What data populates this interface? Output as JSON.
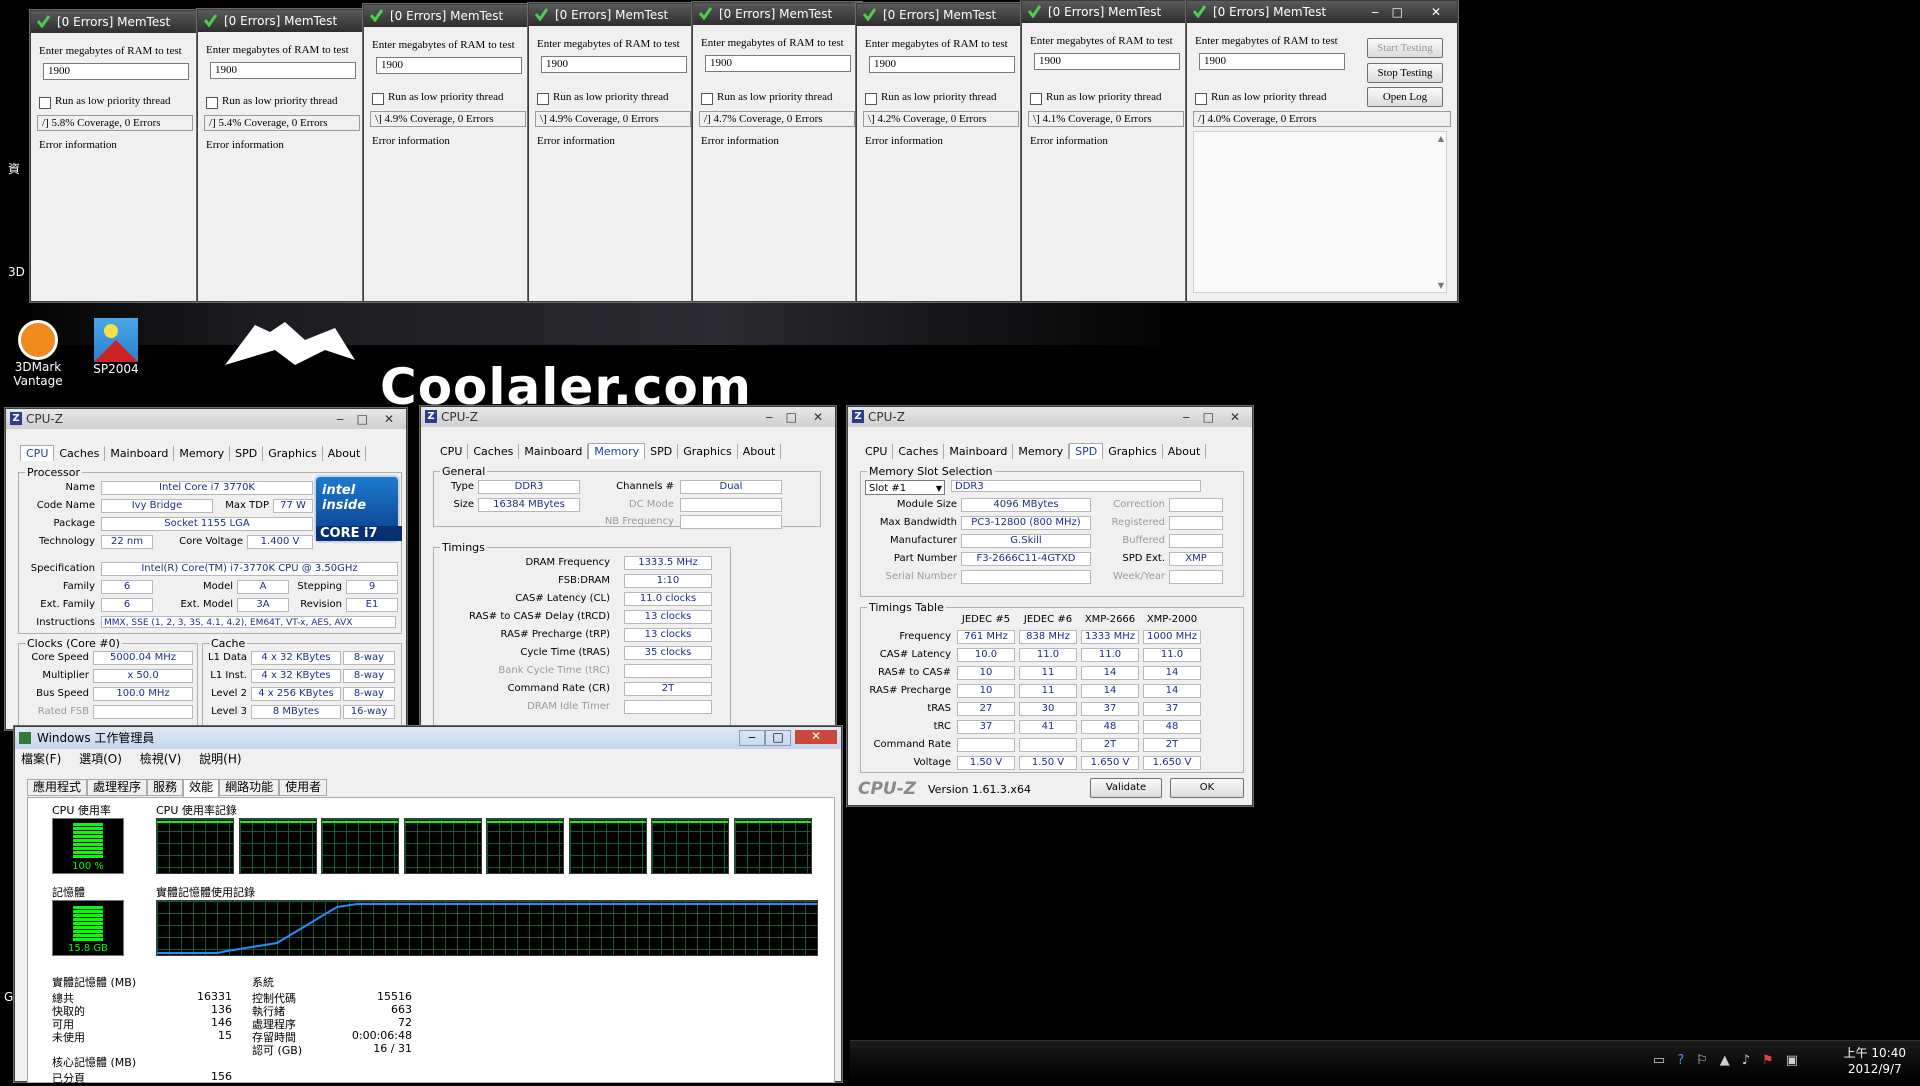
{
  "desktop": {
    "watermark": "Coolaler.com",
    "partial_label_1": "資",
    "partial_label_2": "3D",
    "partial_label_3": "G",
    "icons": [
      {
        "label_line1": "3DMark",
        "label_line2": "Vantage"
      },
      {
        "label_line1": "SP2004"
      }
    ]
  },
  "memtest": {
    "title": "[0 Errors] MemTest",
    "prompt": "Enter megabytes of RAM to test",
    "value": "1900",
    "low_priority": "Run as low priority thread",
    "error_info": "Error information",
    "start": "Start Testing",
    "stop": "Stop Testing",
    "log": "Open Log",
    "windows": [
      {
        "status": "/]   5.8% Coverage, 0 Errors"
      },
      {
        "status": "/]   5.4% Coverage, 0 Errors"
      },
      {
        "status": "\\]   4.9% Coverage, 0 Errors"
      },
      {
        "status": "\\]   4.9% Coverage, 0 Errors"
      },
      {
        "status": "/]   4.7% Coverage, 0 Errors"
      },
      {
        "status": "\\]   4.2% Coverage, 0 Errors"
      },
      {
        "status": "\\]   4.1% Coverage, 0 Errors"
      },
      {
        "status": "/]   4.0% Coverage, 0 Errors"
      }
    ]
  },
  "cpuz": {
    "title": "CPU-Z",
    "tabs": [
      "CPU",
      "Caches",
      "Mainboard",
      "Memory",
      "SPD",
      "Graphics",
      "About"
    ],
    "cpu": {
      "processor_title": "Processor",
      "name_label": "Name",
      "name": "Intel Core i7 3770K",
      "codename_label": "Code Name",
      "codename": "Ivy Bridge",
      "tdp_label": "Max TDP",
      "tdp": "77 W",
      "package_label": "Package",
      "package": "Socket 1155 LGA",
      "tech_label": "Technology",
      "tech": "22 nm",
      "voltage_label": "Core Voltage",
      "voltage": "1.400 V",
      "spec_label": "Specification",
      "spec": "Intel(R) Core(TM) i7-3770K CPU @ 3.50GHz",
      "family_label": "Family",
      "family": "6",
      "model_label": "Model",
      "model": "A",
      "stepping_label": "Stepping",
      "stepping": "9",
      "extfamily_label": "Ext. Family",
      "extfamily": "6",
      "extmodel_label": "Ext. Model",
      "extmodel": "3A",
      "revision_label": "Revision",
      "revision": "E1",
      "instr_label": "Instructions",
      "instr": "MMX, SSE (1, 2, 3, 3S, 4.1, 4.2), EM64T, VT-x, AES, AVX",
      "logo_inside": "intel inside",
      "logo_core": "CORE i7",
      "clocks_title": "Clocks (Core #0)",
      "corespeed_label": "Core Speed",
      "corespeed": "5000.04 MHz",
      "multiplier_label": "Multiplier",
      "multiplier": "x 50.0",
      "bus_label": "Bus Speed",
      "bus": "100.0 MHz",
      "ratedfsb_label": "Rated FSB",
      "cache_title": "Cache",
      "l1d_label": "L1 Data",
      "l1d": "4 x 32 KBytes",
      "l1d_way": "8-way",
      "l1i_label": "L1 Inst.",
      "l1i": "4 x 32 KBytes",
      "l1i_way": "8-way",
      "l2_label": "Level 2",
      "l2": "4 x 256 KBytes",
      "l2_way": "8-way",
      "l3_label": "Level 3",
      "l3": "8 MBytes",
      "l3_way": "16-way"
    },
    "memory": {
      "general_title": "General",
      "type_label": "Type",
      "type": "DDR3",
      "channels_label": "Channels #",
      "channels": "Dual",
      "size_label": "Size",
      "size": "16384 MBytes",
      "dcmode_label": "DC Mode",
      "nbfreq_label": "NB Frequency",
      "timings_title": "Timings",
      "rows": [
        {
          "label": "DRAM Frequency",
          "value": "1333.5 MHz"
        },
        {
          "label": "FSB:DRAM",
          "value": "1:10"
        },
        {
          "label": "CAS# Latency (CL)",
          "value": "11.0 clocks"
        },
        {
          "label": "RAS# to CAS# Delay (tRCD)",
          "value": "13 clocks"
        },
        {
          "label": "RAS# Precharge (tRP)",
          "value": "13 clocks"
        },
        {
          "label": "Cycle Time (tRAS)",
          "value": "35 clocks"
        },
        {
          "label": "Bank Cycle Time (tRC)",
          "value": ""
        },
        {
          "label": "Command Rate (CR)",
          "value": "2T"
        },
        {
          "label": "DRAM Idle Timer",
          "value": ""
        }
      ]
    },
    "spd": {
      "slot_title": "Memory Slot Selection",
      "slot": "Slot #1",
      "slot_type": "DDR3",
      "module_size_label": "Module Size",
      "module_size": "4096 MBytes",
      "max_bw_label": "Max Bandwidth",
      "max_bw": "PC3-12800 (800 MHz)",
      "manufacturer_label": "Manufacturer",
      "manufacturer": "G.Skill",
      "part_label": "Part Number",
      "part": "F3-2666C11-4GTXD",
      "serial_label": "Serial Number",
      "correction_label": "Correction",
      "registered_label": "Registered",
      "buffered_label": "Buffered",
      "spdext_label": "SPD Ext.",
      "spdext": "XMP",
      "weekyear_label": "Week/Year",
      "timings_title": "Timings Table",
      "cols": [
        "JEDEC #5",
        "JEDEC #6",
        "XMP-2666",
        "XMP-2000"
      ],
      "rows": [
        {
          "label": "Frequency",
          "values": [
            "761 MHz",
            "838 MHz",
            "1333 MHz",
            "1000 MHz"
          ]
        },
        {
          "label": "CAS# Latency",
          "values": [
            "10.0",
            "11.0",
            "11.0",
            "11.0"
          ]
        },
        {
          "label": "RAS# to CAS#",
          "values": [
            "10",
            "11",
            "14",
            "14"
          ]
        },
        {
          "label": "RAS# Precharge",
          "values": [
            "10",
            "11",
            "14",
            "14"
          ]
        },
        {
          "label": "tRAS",
          "values": [
            "27",
            "30",
            "37",
            "37"
          ]
        },
        {
          "label": "tRC",
          "values": [
            "37",
            "41",
            "48",
            "48"
          ]
        },
        {
          "label": "Command Rate",
          "values": [
            "",
            "",
            "2T",
            "2T"
          ]
        },
        {
          "label": "Voltage",
          "values": [
            "1.50 V",
            "1.50 V",
            "1.650 V",
            "1.650 V"
          ]
        }
      ],
      "brand": "CPU-Z",
      "version": "Version 1.61.3.x64",
      "validate": "Validate",
      "ok": "OK"
    }
  },
  "taskmgr": {
    "title": "Windows 工作管理員",
    "menu": [
      "檔案(F)",
      "選項(O)",
      "檢視(V)",
      "說明(H)"
    ],
    "tabs": [
      "應用程式",
      "處理程序",
      "服務",
      "效能",
      "網路功能",
      "使用者"
    ],
    "cpu_usage_label": "CPU 使用率",
    "cpu_usage_value": "100 %",
    "cpu_history_label": "CPU 使用率記錄",
    "mem_label": "記憶體",
    "mem_value": "15.8 GB",
    "mem_history_label": "實體記憶體使用記錄",
    "phys_title": "實體記憶體 (MB)",
    "phys_rows": [
      {
        "label": "總共",
        "value": "16331"
      },
      {
        "label": "快取的",
        "value": "136"
      },
      {
        "label": "可用",
        "value": "146"
      },
      {
        "label": "未使用",
        "value": "15"
      }
    ],
    "system_title": "系統",
    "system_rows": [
      {
        "label": "控制代碼",
        "value": "15516"
      },
      {
        "label": "執行緒",
        "value": "663"
      },
      {
        "label": "處理程序",
        "value": "72"
      },
      {
        "label": "存留時間",
        "value": "0:00:06:48"
      },
      {
        "label": "認可 (GB)",
        "value": "16 / 31"
      }
    ],
    "kernel_title": "核心記憶體 (MB)",
    "kernel_row_label": "已分頁",
    "kernel_row_value": "156",
    "cpu_usage": 1.0,
    "mem_usage": 0.97
  },
  "taskbar": {
    "time": "上午 10:40",
    "date": "2012/9/7"
  },
  "colors": {
    "graph_green": "#00ff00",
    "graph_grid": "#0b5f2a",
    "cpuz_value": "#1a2f8a",
    "memtest_title": "#2e2e2e"
  }
}
